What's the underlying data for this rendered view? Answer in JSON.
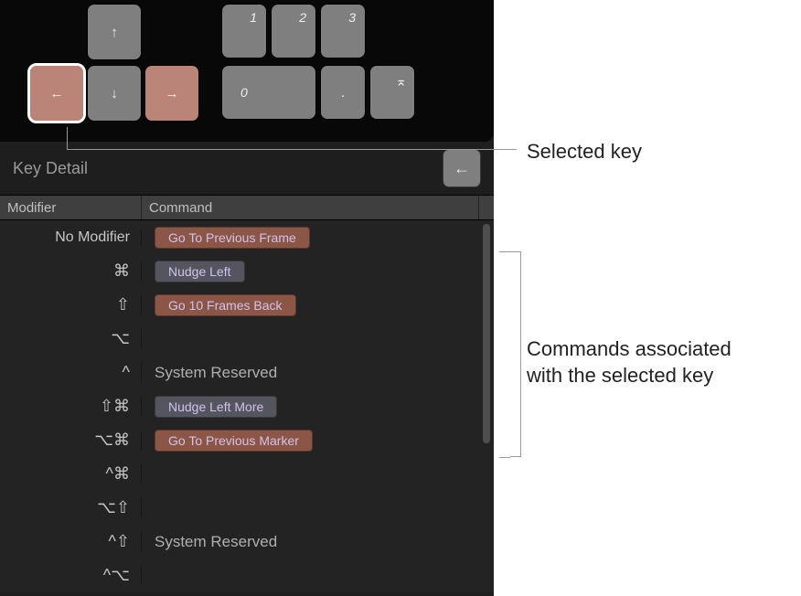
{
  "annotations": {
    "selected_key": "Selected key",
    "commands_line1": "Commands associated",
    "commands_line2": "with the selected key"
  },
  "keyboard": {
    "up_glyph": "↑",
    "down_glyph": "↓",
    "left_glyph": "←",
    "right_glyph": "→",
    "k1": "1",
    "k2": "2",
    "k3": "3",
    "k0": "0",
    "kdot": ".",
    "enter_glyph": "⌅"
  },
  "detail": {
    "title": "Key Detail",
    "mini_key_glyph": "←"
  },
  "table": {
    "head_modifier": "Modifier",
    "head_command": "Command",
    "rows": [
      {
        "mod": "No Modifier",
        "cmd": "Go To Previous Frame",
        "kind": "red"
      },
      {
        "mod": "⌘",
        "cmd": "Nudge Left",
        "kind": "gray"
      },
      {
        "mod": "⇧",
        "cmd": "Go 10 Frames Back",
        "kind": "red"
      },
      {
        "mod": "⌥",
        "cmd": "",
        "kind": ""
      },
      {
        "mod": "^",
        "cmd": "System Reserved",
        "kind": "reserved"
      },
      {
        "mod": "⇧⌘",
        "cmd": "Nudge Left More",
        "kind": "gray"
      },
      {
        "mod": "⌥⌘",
        "cmd": "Go To Previous Marker",
        "kind": "red"
      },
      {
        "mod": "^⌘",
        "cmd": "",
        "kind": ""
      },
      {
        "mod": "⌥⇧",
        "cmd": "",
        "kind": ""
      },
      {
        "mod": "^⇧",
        "cmd": "System Reserved",
        "kind": "reserved"
      },
      {
        "mod": "^⌥",
        "cmd": "",
        "kind": ""
      }
    ]
  }
}
